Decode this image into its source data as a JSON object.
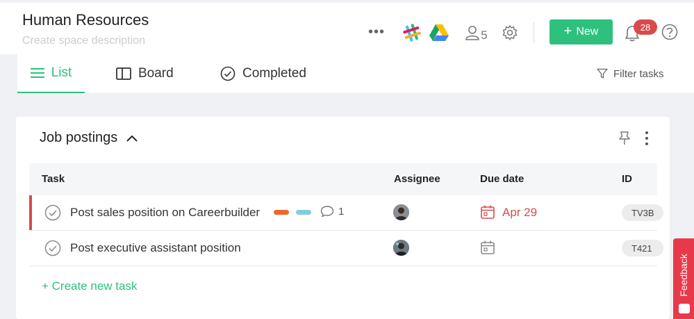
{
  "header": {
    "title": "Human Resources",
    "description_placeholder": "Create space description",
    "members_count": "5",
    "new_button_label": "New",
    "notification_count": "28",
    "icons": [
      "more-icon",
      "slack-icon",
      "google-drive-icon",
      "members-icon",
      "gear-icon",
      "bell-icon",
      "help-icon"
    ]
  },
  "tabs": {
    "list": "List",
    "board": "Board",
    "completed": "Completed",
    "filter": "Filter tasks"
  },
  "section": {
    "title": "Job postings",
    "columns": {
      "task": "Task",
      "assignee": "Assignee",
      "due_date": "Due date",
      "id": "ID"
    },
    "tasks": [
      {
        "name": "Post sales position on Careerbuilder",
        "tags": [
          "#f0662a",
          "#7fd0dc"
        ],
        "comments": "1",
        "due": "Apr 29",
        "id": "TV3B",
        "overdue": true
      },
      {
        "name": "Post executive assistant position",
        "tags": [],
        "comments": "",
        "due": "",
        "id": "T421",
        "overdue": false
      }
    ],
    "create_label": "+ Create new task"
  },
  "feedback": {
    "label": "Feedback"
  },
  "colors": {
    "accent": "#2ec07d",
    "danger": "#d94b4b",
    "feedback": "#e8394a"
  }
}
